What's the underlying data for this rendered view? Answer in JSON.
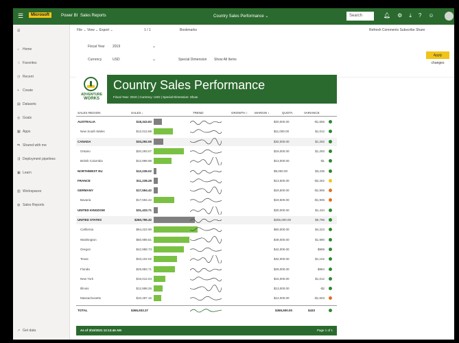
{
  "topbar": {
    "waffle": "☰",
    "brand": "Microsoft",
    "product": "Power BI",
    "workspace": "Sales Reports",
    "title": "Country Sales Performance ⌄",
    "search_placeholder": "Search",
    "icons": [
      "bell-icon",
      "gear-icon",
      "download-icon",
      "help-icon",
      "smile-icon"
    ]
  },
  "sidebar": {
    "items": [
      {
        "label": "Home",
        "icon": "⌂"
      },
      {
        "label": "Favorites",
        "icon": "☆"
      },
      {
        "label": "Recent",
        "icon": "◷"
      },
      {
        "label": "Create",
        "icon": "+"
      },
      {
        "label": "Datasets",
        "icon": "▤"
      },
      {
        "label": "Goals",
        "icon": "◎"
      },
      {
        "label": "Apps",
        "icon": "▦"
      },
      {
        "label": "Shared with me",
        "icon": "⇆"
      },
      {
        "label": "Deployment pipelines",
        "icon": "⇶"
      },
      {
        "label": "Learn",
        "icon": "▣"
      },
      {
        "label": "Workspaces",
        "icon": "▥"
      },
      {
        "label": "Sales Reports",
        "icon": "◍"
      }
    ],
    "bottom": "Get data"
  },
  "actionbar": {
    "file": "File ⌄   View ⌄   Export ⌄",
    "page": "1 / 1",
    "bookmarks": "Bookmarks",
    "right": "Refresh   Comments   Subscribe   Share"
  },
  "filters": {
    "fiscal_year_label": "Fiscal Year",
    "fiscal_year_value": "2019",
    "currency_label": "Currency",
    "currency_value": "USD",
    "special_label": "Special Dimension",
    "special_value": "Show All Items",
    "apply_label": "Apply changes"
  },
  "report": {
    "logo_line1": "ADVENTURE",
    "logo_line2": "WORKS",
    "title": "Country Sales Performance",
    "subtitle": "Fiscal Year: 2019 | Currency: USD | Special Dimension: Show",
    "headers": [
      "SALES REGION",
      "SALES ↓",
      "TREND",
      "GROWTH ↕",
      "MARGIN ↕",
      "QUOTA",
      "VARIANCE"
    ],
    "rows": [
      {
        "name": "AUSTRALIA",
        "sales": "$18,343.83",
        "bar": 12,
        "growth": "",
        "margin": "",
        "quota": "$20,000.00",
        "var": "-$1,656",
        "dot": "#2b8a2e",
        "bold": true,
        "hl": false
      },
      {
        "name": "New South Wales",
        "sales": "$12,012.88",
        "bar": 28,
        "growth": "",
        "margin": "",
        "quota": "$11,000.00",
        "var": "$1,012",
        "dot": "#2b8a2e",
        "bold": false,
        "hl": false
      },
      {
        "name": "CANADA",
        "sales": "$33,292.05",
        "bar": 14,
        "growth": "",
        "margin": "",
        "quota": "$32,000.00",
        "var": "$1,292",
        "dot": "#2b8a2e",
        "bold": true,
        "hl": true
      },
      {
        "name": "Ontario",
        "sales": "$20,293.07",
        "bar": 44,
        "growth": "",
        "margin": "",
        "quota": "$19,000.00",
        "var": "$1,293",
        "dot": "#2b8a2e",
        "bold": false,
        "hl": false
      },
      {
        "name": "British Columbia",
        "sales": "$12,998.98",
        "bar": 26,
        "growth": "",
        "margin": "",
        "quota": "$13,000.00",
        "var": "-$1",
        "dot": "#2b8a2e",
        "bold": false,
        "hl": false
      },
      {
        "name": "NORTHWEST EU",
        "sales": "$12,236.02",
        "bar": 4,
        "growth": "",
        "margin": "",
        "quota": "$9,000.00",
        "var": "$3,236",
        "dot": "#2b8a2e",
        "bold": true,
        "hl": false
      },
      {
        "name": "FRANCE",
        "sales": "$11,238.28",
        "bar": 6,
        "growth": "",
        "margin": "",
        "quota": "$13,500.00",
        "var": "-$2,262",
        "dot": "#f0c419",
        "bold": true,
        "hl": false
      },
      {
        "name": "GERMANY",
        "sales": "$17,594.42",
        "bar": 6,
        "growth": "",
        "margin": "",
        "quota": "$19,500.00",
        "var": "-$1,906",
        "dot": "#e07020",
        "bold": true,
        "hl": false
      },
      {
        "name": "Bavaria",
        "sales": "$17,594.42",
        "bar": 30,
        "growth": "",
        "margin": "",
        "quota": "$19,500.00",
        "var": "-$1,906",
        "dot": "#e07020",
        "bold": false,
        "hl": false
      },
      {
        "name": "UNITED KINGDOM",
        "sales": "$31,433.71",
        "bar": 6,
        "growth": "",
        "margin": "",
        "quota": "$30,000.00",
        "var": "$1,434",
        "dot": "#2b8a2e",
        "bold": true,
        "hl": false
      },
      {
        "name": "UNITED STATES",
        "sales": "$260,795.32",
        "bar": 60,
        "growth": "",
        "margin": "",
        "quota": "$255,000.00",
        "var": "$5,795",
        "dot": "#2b8a2e",
        "bold": true,
        "hl": true
      },
      {
        "name": "California",
        "sales": "$64,222.90",
        "bar": 64,
        "growth": "",
        "margin": "",
        "quota": "$60,000.00",
        "var": "$4,223",
        "dot": "#2b8a2e",
        "bold": false,
        "hl": false
      },
      {
        "name": "Washington",
        "sales": "$50,989.51",
        "bar": 52,
        "growth": "",
        "margin": "",
        "quota": "$49,000.00",
        "var": "$1,990",
        "dot": "#2b8a2e",
        "bold": false,
        "hl": false
      },
      {
        "name": "Oregon",
        "sales": "$42,988.73",
        "bar": 44,
        "growth": "",
        "margin": "",
        "quota": "$42,000.00",
        "var": "$989",
        "dot": "#2b8a2e",
        "bold": false,
        "hl": false
      },
      {
        "name": "Texas",
        "sales": "$33,102.02",
        "bar": 34,
        "growth": "",
        "margin": "",
        "quota": "$32,000.00",
        "var": "$1,102",
        "dot": "#2b8a2e",
        "bold": false,
        "hl": false
      },
      {
        "name": "Florida",
        "sales": "$29,983.71",
        "bar": 31,
        "growth": "",
        "margin": "",
        "quota": "$29,000.00",
        "var": "$984",
        "dot": "#2b8a2e",
        "bold": false,
        "hl": false
      },
      {
        "name": "New York",
        "sales": "$16,012.04",
        "bar": 17,
        "growth": "",
        "margin": "",
        "quota": "$15,000.00",
        "var": "$1,012",
        "dot": "#2b8a2e",
        "bold": false,
        "hl": false
      },
      {
        "name": "Illinois",
        "sales": "$12,998.26",
        "bar": 13,
        "growth": "",
        "margin": "",
        "quota": "$13,000.00",
        "var": "-$2",
        "dot": "#2b8a2e",
        "bold": false,
        "hl": false
      },
      {
        "name": "Massachusetts",
        "sales": "$10,497.15",
        "bar": 11,
        "growth": "",
        "margin": "",
        "quota": "$12,000.00",
        "var": "-$1,503",
        "dot": "#e07020",
        "bold": false,
        "hl": false
      }
    ],
    "total_label": "TOTAL",
    "total_sales": "$365,933.37",
    "total_quota": "$365,500.00",
    "total_var": "$433",
    "footer_left": "As of 3/10/2021 12:13:45 AM",
    "footer_right": "Page 1 of 1"
  },
  "colors": {
    "brand": "#2b6a2e",
    "bar_country": "#7f7f7f",
    "bar_region": "#7ac143",
    "accent": "#f0c419"
  }
}
